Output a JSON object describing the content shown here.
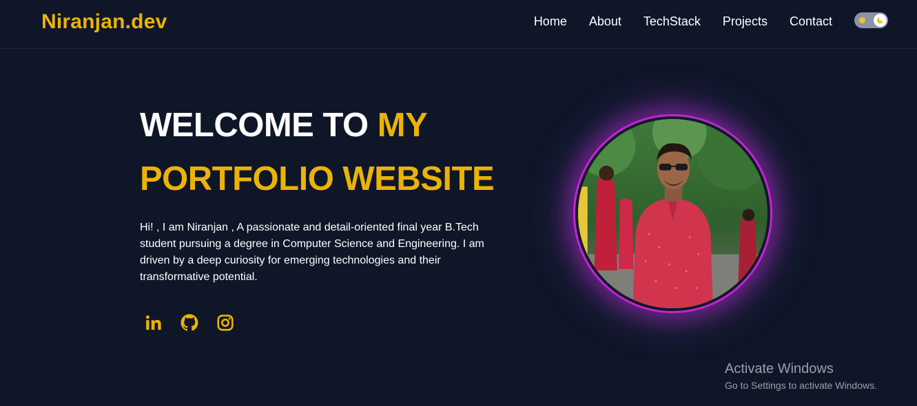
{
  "brand": "Niranjan.dev",
  "nav": {
    "items": [
      "Home",
      "About",
      "TechStack",
      "Projects",
      "Contact"
    ]
  },
  "theme_toggle": {
    "mode": "dark"
  },
  "hero": {
    "title_line1": "WELCOME TO ",
    "title_accent1": "MY",
    "title_line2": "PORTFOLIO WEBSITE",
    "description": "Hi! , I am Niranjan , A passionate and detail-oriented final year B.Tech student pursuing a degree in Computer Science and Engineering. I am driven by a deep curiosity for emerging technologies and their transformative potential."
  },
  "socials": [
    "linkedin-icon",
    "github-icon",
    "instagram-icon"
  ],
  "watermark": {
    "title": "Activate Windows",
    "subtitle": "Go to Settings to activate Windows."
  },
  "colors": {
    "background": "#0f1628",
    "accent": "#eab308",
    "ring": "#c026d3"
  }
}
